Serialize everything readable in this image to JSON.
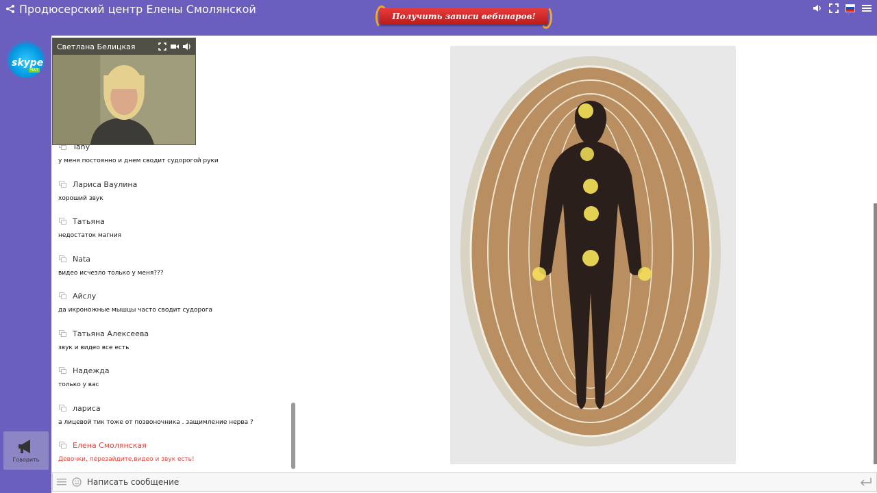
{
  "header": {
    "title": "Продюсерский центр Елены Смолянской",
    "promo_label": "Получить записи вебинаров!",
    "icons": [
      "share-icon",
      "volume-icon",
      "fullscreen-icon",
      "language-flag-ru",
      "menu-icon"
    ]
  },
  "sidebar": {
    "skype_label": "skype",
    "skype_badge": "ЧАТ",
    "speak_label": "Говорить"
  },
  "video": {
    "presenter_name": "Светлана Белицкая",
    "controls": [
      "fullscreen-icon",
      "camera-icon",
      "volume-icon"
    ]
  },
  "chat": {
    "messages": [
      {
        "author": "Tany",
        "text": "у меня постоянно и днем сводит судорогой руки",
        "admin": false
      },
      {
        "author": "Лариса Ваулина",
        "text": "хороший звук",
        "admin": false
      },
      {
        "author": "Татьяна",
        "text": "недостаток магния",
        "admin": false
      },
      {
        "author": "Nata",
        "text": "видео исчезло только у меня???",
        "admin": false
      },
      {
        "author": "Айслу",
        "text": "да икроножные мышцы часто сводит судорога",
        "admin": false
      },
      {
        "author": "Татьяна Алексеева",
        "text": "звук и видео все есть",
        "admin": false
      },
      {
        "author": "Надежда",
        "text": "только у вас",
        "admin": false
      },
      {
        "author": "лариса",
        "text": "а лицевой тик тоже от позвоночника . защимление нерва ?",
        "admin": false
      },
      {
        "author": "Елена Смолянская",
        "text": "Девочки, перезайдите,видео и звук есть!",
        "admin": true
      }
    ]
  },
  "input": {
    "placeholder": "Написать сообщение"
  },
  "colors": {
    "brand": "#6a5fbf",
    "admin": "#e0443a",
    "promo": "#d32f2f"
  }
}
